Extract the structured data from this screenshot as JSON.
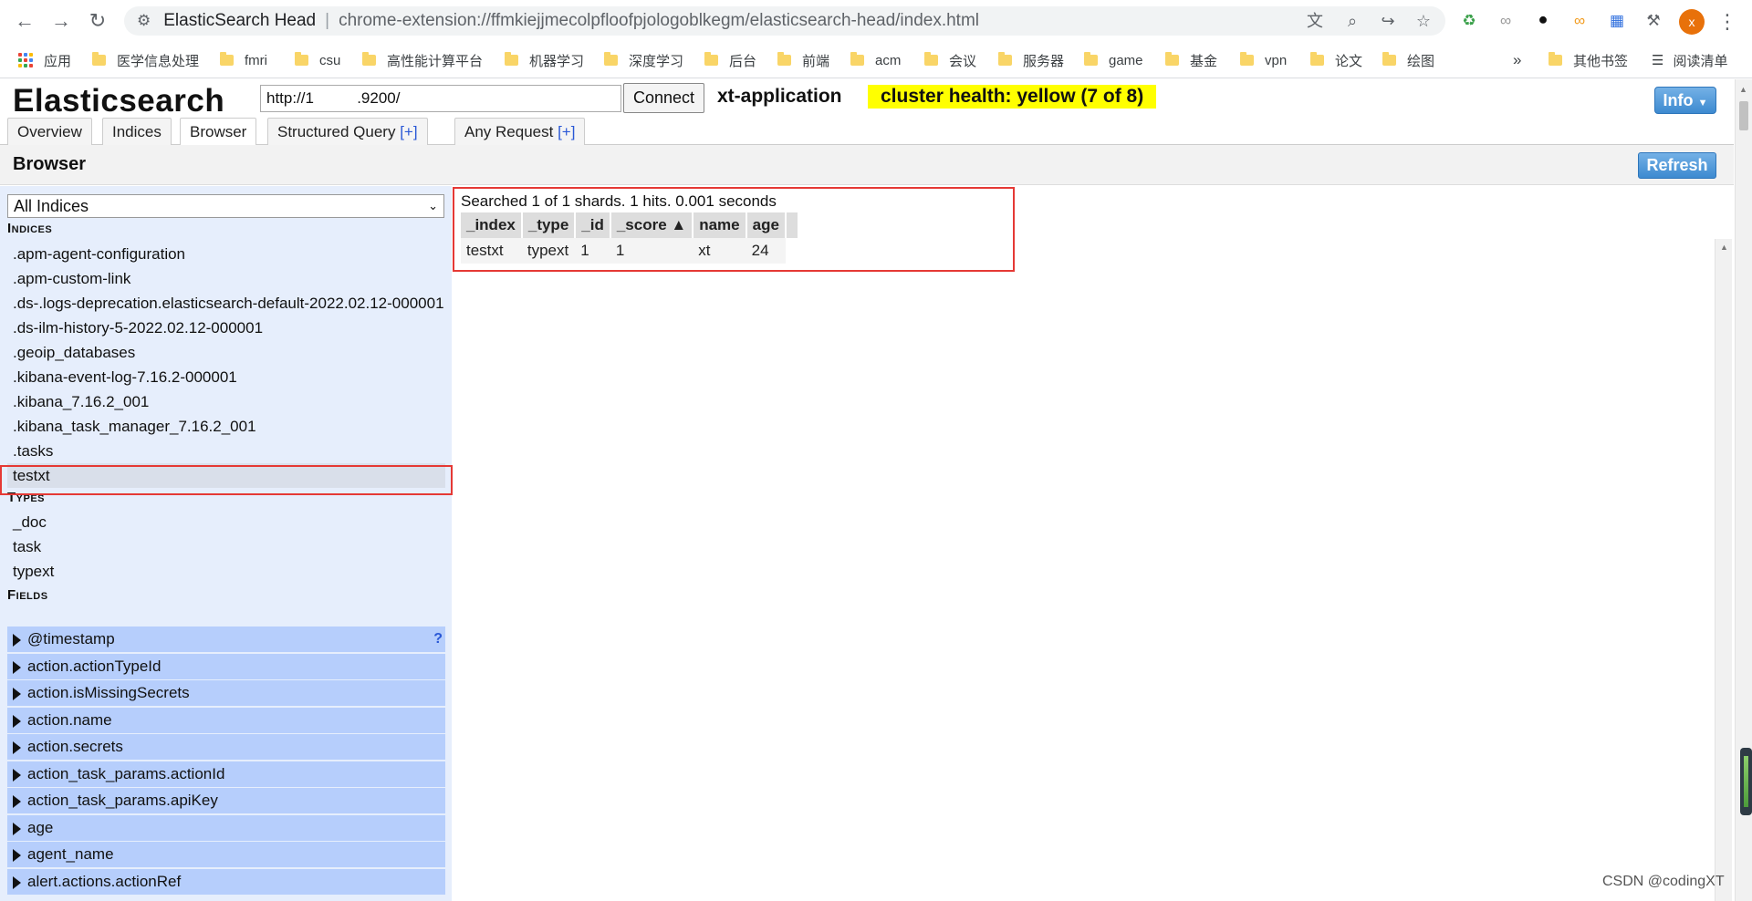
{
  "chrome": {
    "tab_title": "ElasticSearch Head",
    "separator": "|",
    "url": "chrome-extension://ffmkiejjmecolpfloofpjologoblkegm/elasticsearch-head/index.html",
    "avatar_letter": "x"
  },
  "bookmarks": [
    {
      "label": "应用",
      "icon": "apps-icon"
    },
    {
      "label": "医学信息处理",
      "icon": "folder-icon"
    },
    {
      "label": "fmri",
      "icon": "folder-icon"
    },
    {
      "label": "csu",
      "icon": "folder-icon"
    },
    {
      "label": "高性能计算平台",
      "icon": "folder-icon"
    },
    {
      "label": "机器学习",
      "icon": "folder-icon"
    },
    {
      "label": "深度学习",
      "icon": "folder-icon"
    },
    {
      "label": "后台",
      "icon": "folder-icon"
    },
    {
      "label": "前端",
      "icon": "folder-icon"
    },
    {
      "label": "acm",
      "icon": "folder-icon"
    },
    {
      "label": "会议",
      "icon": "folder-icon"
    },
    {
      "label": "服务器",
      "icon": "folder-icon"
    },
    {
      "label": "game",
      "icon": "folder-icon"
    },
    {
      "label": "基金",
      "icon": "folder-icon"
    },
    {
      "label": "vpn",
      "icon": "folder-icon"
    },
    {
      "label": "论文",
      "icon": "folder-icon"
    },
    {
      "label": "绘图",
      "icon": "folder-icon"
    }
  ],
  "bookmarks_overflow": "»",
  "other_bookmarks": "其他书签",
  "reading_list": "阅读清单",
  "app": {
    "logo": "Elasticsearch",
    "connect_url": "http://1          .9200/",
    "connect_label": "Connect",
    "cluster_name": "xt-application",
    "cluster_health": "cluster health: yellow (7 of 8)",
    "info_label": "Info",
    "tabs": [
      {
        "label": "Overview"
      },
      {
        "label": "Indices"
      },
      {
        "label": "Browser"
      },
      {
        "label": "Structured Query",
        "plus": "[+]"
      },
      {
        "label": "Any Request",
        "plus": "[+]"
      }
    ],
    "browser_title": "Browser",
    "refresh_label": "Refresh"
  },
  "sidebar": {
    "select_value": "All Indices",
    "indices_title": "Indices",
    "indices": [
      ".apm-agent-configuration",
      ".apm-custom-link",
      ".ds-.logs-deprecation.elasticsearch-default-2022.02.12-000001",
      ".ds-ilm-history-5-2022.02.12-000001",
      ".geoip_databases",
      ".kibana-event-log-7.16.2-000001",
      ".kibana_7.16.2_001",
      ".kibana_task_manager_7.16.2_001",
      ".tasks",
      "testxt"
    ],
    "types_title": "Types",
    "types": [
      "_doc",
      "task",
      "typext"
    ],
    "fields_title": "Fields",
    "fields": [
      "@timestamp",
      "action.actionTypeId",
      "action.isMissingSecrets",
      "action.name",
      "action.secrets",
      "action_task_params.actionId",
      "action_task_params.apiKey",
      "age",
      "agent_name",
      "alert.actions.actionRef"
    ],
    "help_mark": "?"
  },
  "results": {
    "summary": "Searched 1 of 1 shards. 1 hits. 0.001 seconds",
    "columns": [
      "_index",
      "_type",
      "_id",
      "_score ▲",
      "name",
      "age",
      ""
    ],
    "rows": [
      [
        "testxt",
        "typext",
        "1",
        "1",
        "xt",
        "24"
      ]
    ]
  },
  "watermark": "CSDN @codingXT"
}
